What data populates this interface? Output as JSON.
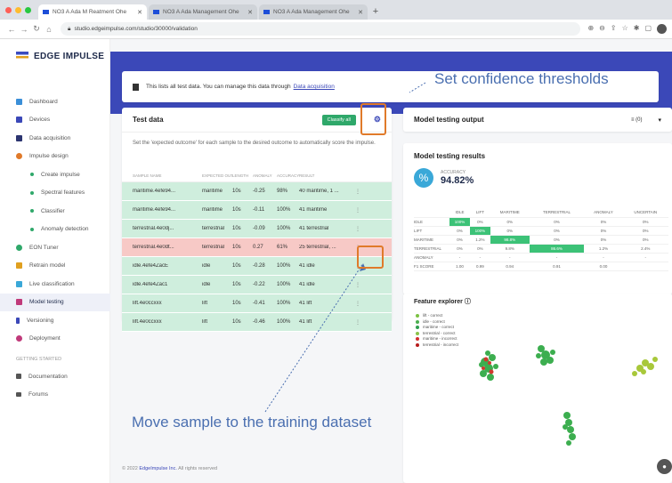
{
  "browser": {
    "tabs": [
      {
        "title": "NO3 A Ada M Reatment Ohe",
        "active": true
      },
      {
        "title": "NO3 A Ada Management Ohe",
        "active": false
      },
      {
        "title": "NO3 A Ada Management Ohe",
        "active": false
      }
    ],
    "new_tab": "+",
    "url": "studio.edgeimpulse.com/studio/30000/validation"
  },
  "sidebar": {
    "logo": "EDGE IMPULSE",
    "items": [
      {
        "label": "Dashboard",
        "color": "#3b8fd8"
      },
      {
        "label": "Devices",
        "color": "#3b48b8"
      },
      {
        "label": "Data acquisition",
        "color": "#2c3570"
      },
      {
        "label": "Impulse design",
        "color": "#e07a2a"
      }
    ],
    "sub_items": [
      "Create impulse",
      "Spectral features",
      "Classifier",
      "Anomaly detection"
    ],
    "items2": [
      {
        "label": "EON Tuner",
        "color": "#2fa86a"
      },
      {
        "label": "Retrain model",
        "color": "#e0a020"
      },
      {
        "label": "Live classification",
        "color": "#3aa8d8"
      },
      {
        "label": "Model testing",
        "color": "#c03a7a"
      },
      {
        "label": "Versioning",
        "color": "#3b48b8"
      },
      {
        "label": "Deployment",
        "color": "#c03a7a"
      }
    ],
    "section_heading": "GETTING STARTED",
    "items3": [
      {
        "label": "Documentation",
        "color": "#555"
      },
      {
        "label": "Forums",
        "color": "#555"
      }
    ]
  },
  "notice": {
    "text": "This lists all test data. You can manage this data through",
    "link": "Data acquisition"
  },
  "test_data": {
    "title": "Test data",
    "classify_label": "Classify all",
    "description": "Set the 'expected outcome' for each sample to the desired outcome to automatically score the impulse.",
    "columns": [
      "SAMPLE NAME",
      "EXPECTED OUTCOME",
      "LENGTH",
      "ANOMALY",
      "ACCURACY",
      "RESULT"
    ],
    "rows": [
      {
        "name": "maritime.4efe94...",
        "expected": "maritime",
        "length": "10s",
        "anomaly": "-0.25",
        "accuracy": "98%",
        "result": "40 maritime, 1 ...",
        "status": "ok"
      },
      {
        "name": "maritime.4efe94...",
        "expected": "maritime",
        "length": "10s",
        "anomaly": "-0.11",
        "accuracy": "100%",
        "result": "41 maritime",
        "status": "ok"
      },
      {
        "name": "terrestrial.4e0dj...",
        "expected": "terrestrial",
        "length": "10s",
        "anomaly": "-0.09",
        "accuracy": "100%",
        "result": "41 terrestrial",
        "status": "ok"
      },
      {
        "name": "terrestrial.4e0dt...",
        "expected": "terrestrial",
        "length": "10s",
        "anomaly": "0.27",
        "accuracy": "61%",
        "result": "25 terrestrial, ...",
        "status": "bad"
      },
      {
        "name": "idle.4efe4ZacE",
        "expected": "idle",
        "length": "10s",
        "anomaly": "-0.28",
        "accuracy": "100%",
        "result": "41 idle",
        "status": "ok"
      },
      {
        "name": "idle.4efe4Zac1",
        "expected": "idle",
        "length": "10s",
        "anomaly": "-0.22",
        "accuracy": "100%",
        "result": "41 idle",
        "status": "ok"
      },
      {
        "name": "lift.4e0ccxxx",
        "expected": "lift",
        "length": "10s",
        "anomaly": "-0.41",
        "accuracy": "100%",
        "result": "41 lift",
        "status": "ok"
      },
      {
        "name": "lift.4e0ccxxx",
        "expected": "lift",
        "length": "10s",
        "anomaly": "-0.46",
        "accuracy": "100%",
        "result": "41 lift",
        "status": "ok"
      }
    ]
  },
  "model_output": {
    "title": "Model testing output",
    "selected": "≡ (0)"
  },
  "results": {
    "title": "Model testing results",
    "accuracy_label": "ACCURACY",
    "accuracy_value": "94.82%",
    "matrix_headers": [
      "",
      "IDLE",
      "LIFT",
      "MARITIME",
      "TERRESTRIAL",
      "ANOMALY",
      "UNCERTAIN"
    ],
    "matrix_rows": [
      [
        "IDLE",
        "100%",
        "0%",
        "0%",
        "0%",
        "0%",
        "0%"
      ],
      [
        "LIFT",
        "0%",
        "100%",
        "0%",
        "0%",
        "0%",
        "0%"
      ],
      [
        "MARITIME",
        "0%",
        "1.2%",
        "98.8%",
        "0%",
        "0%",
        "0%"
      ],
      [
        "TERRESTRIAL",
        "0%",
        "0%",
        "9.8%",
        "86.6%",
        "1.2%",
        "2.4%"
      ],
      [
        "ANOMALY",
        "-",
        "-",
        "-",
        "-",
        "-",
        "-"
      ],
      [
        "F1 SCORE",
        "1.00",
        "0.99",
        "0.94",
        "0.91",
        "0.00",
        ""
      ]
    ],
    "highlight_cells": [
      [
        0,
        1
      ],
      [
        1,
        2
      ],
      [
        2,
        3
      ],
      [
        3,
        4
      ]
    ]
  },
  "feature_explorer": {
    "title": "Feature explorer",
    "legend": [
      {
        "label": "lift - correct",
        "color": "#7cc243"
      },
      {
        "label": "idle - correct",
        "color": "#4caf50"
      },
      {
        "label": "maritime - correct",
        "color": "#2e9e4f"
      },
      {
        "label": "terrestrial - correct",
        "color": "#8bc34a"
      },
      {
        "label": "maritime - incorrect",
        "color": "#d32f2f"
      },
      {
        "label": "terrestrial - incorrect",
        "color": "#b71c1c"
      }
    ]
  },
  "footer": {
    "prefix": "© 2022",
    "link": "EdgeImpulse Inc.",
    "suffix": "All rights reserved"
  },
  "annotations": {
    "top": "Set confidence thresholds",
    "bottom": "Move sample to the training dataset",
    "color": "#4a6fb0",
    "box_color": "#e07a2a"
  }
}
